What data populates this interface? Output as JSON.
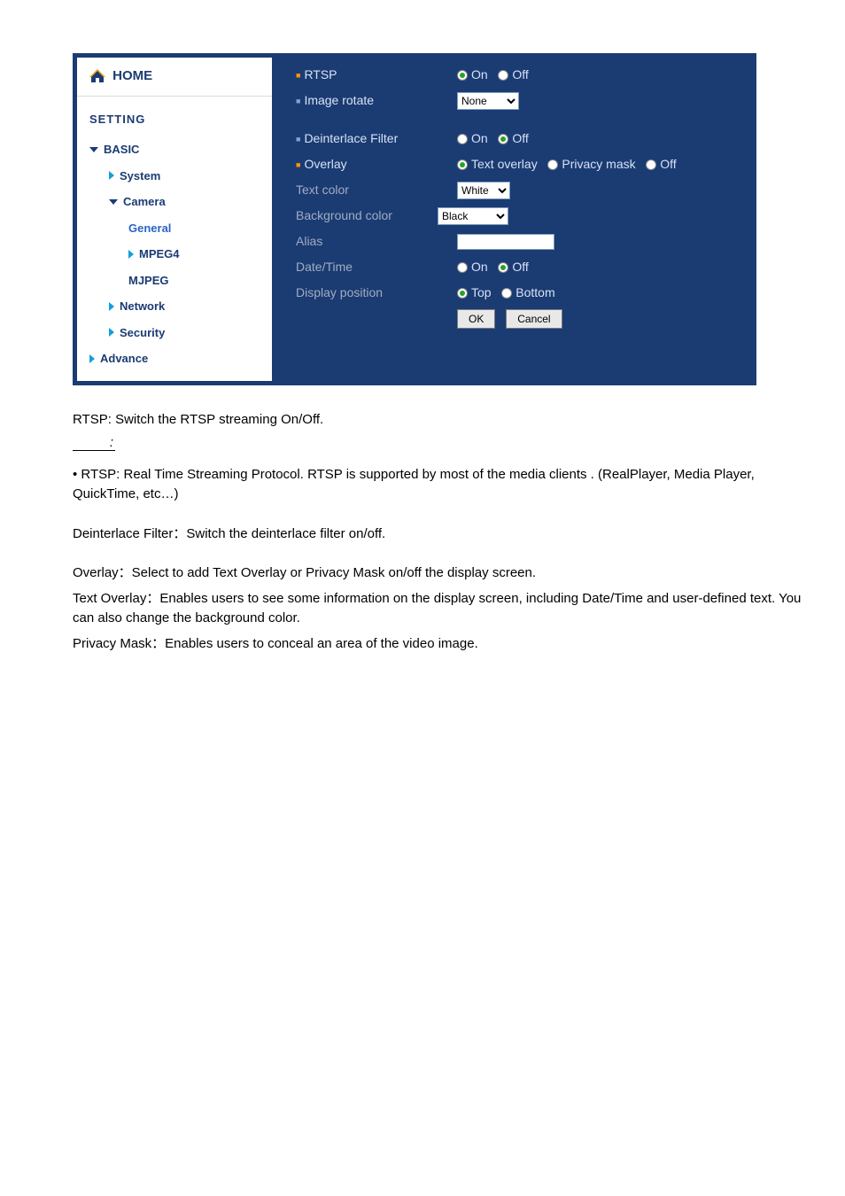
{
  "sidebar": {
    "home": "HOME",
    "setting": "SETTING",
    "items": [
      {
        "label": "BASIC"
      },
      {
        "label": "System"
      },
      {
        "label": "Camera"
      },
      {
        "label": "General"
      },
      {
        "label": "MPEG4"
      },
      {
        "label": "MJPEG"
      },
      {
        "label": "Network"
      },
      {
        "label": "Security"
      },
      {
        "label": "Advance"
      }
    ]
  },
  "form": {
    "rtsp": {
      "label": "RTSP",
      "on": "On",
      "off": "Off"
    },
    "rotate": {
      "label": "Image rotate",
      "value": "None"
    },
    "deinterlace": {
      "label": "Deinterlace Filter",
      "on": "On",
      "off": "Off"
    },
    "overlay": {
      "label": "Overlay",
      "opt1": "Text overlay",
      "opt2": "Privacy mask",
      "off": "Off"
    },
    "textcolor": {
      "label": "Text color",
      "value": "White"
    },
    "bgcolor": {
      "label": "Background color",
      "value": "Black"
    },
    "alias": {
      "label": "Alias",
      "value": ""
    },
    "datetime": {
      "label": "Date/Time",
      "on": "On",
      "off": "Off"
    },
    "dispos": {
      "label": "Display position",
      "top": "Top",
      "bottom": "Bottom"
    },
    "ok": "OK",
    "cancel": "Cancel"
  },
  "doc": {
    "p1": "RTSP: Switch the RTSP streaming On/Off.",
    "p2": "• RTSP: Real Time Streaming Protocol. RTSP is supported by most of the media clients . (RealPlayer, Media Player, QuickTime, etc…)",
    "p3": "Deinterlace Filter：Switch the deinterlace filter on/off.",
    "p4": "Overlay：Select to add Text Overlay or Privacy Mask on/off the display screen.",
    "p5": "Text Overlay：Enables users to see some information on the display screen, including Date/Time and user-defined text. You can also change the background color.",
    "p6": "Privacy Mask：Enables users to conceal an area of the video image."
  }
}
